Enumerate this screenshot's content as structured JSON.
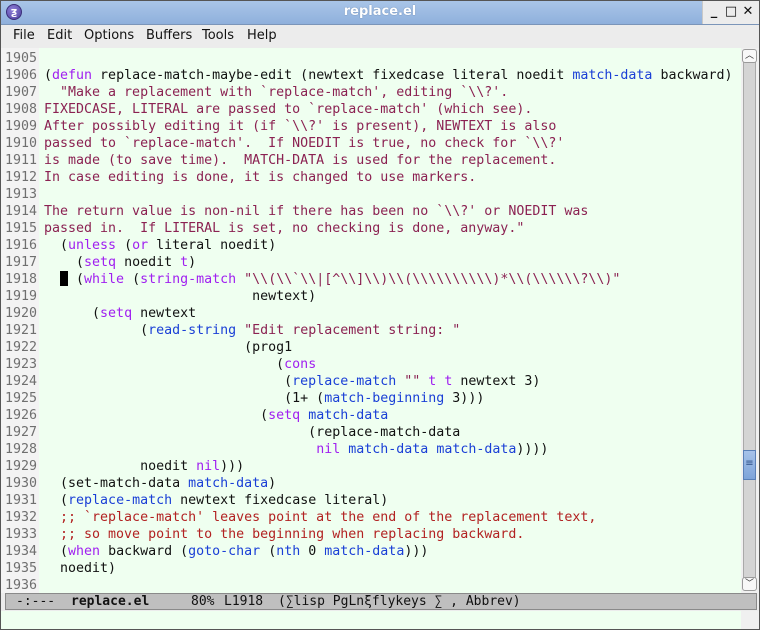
{
  "window": {
    "title": "replace.el",
    "app_icon": "emacs-icon",
    "controls": {
      "minimize": "_",
      "maximize": "□",
      "close": "✕"
    }
  },
  "menubar": {
    "items": [
      "File",
      "Edit",
      "Options",
      "Buffers",
      "Tools",
      "Help"
    ]
  },
  "editor": {
    "cursor_line": 1918,
    "lines": [
      {
        "n": "1905"
      },
      {
        "n": "1906"
      },
      {
        "n": "1907"
      },
      {
        "n": "1908"
      },
      {
        "n": "1909"
      },
      {
        "n": "1910"
      },
      {
        "n": "1911"
      },
      {
        "n": "1912"
      },
      {
        "n": "1913"
      },
      {
        "n": "1914"
      },
      {
        "n": "1915"
      },
      {
        "n": "1916"
      },
      {
        "n": "1917"
      },
      {
        "n": "1918"
      },
      {
        "n": "1919"
      },
      {
        "n": "1920"
      },
      {
        "n": "1921"
      },
      {
        "n": "1922"
      },
      {
        "n": "1923"
      },
      {
        "n": "1924"
      },
      {
        "n": "1925"
      },
      {
        "n": "1926"
      },
      {
        "n": "1927"
      },
      {
        "n": "1928"
      },
      {
        "n": "1929"
      },
      {
        "n": "1930"
      },
      {
        "n": "1931"
      },
      {
        "n": "1932"
      },
      {
        "n": "1933"
      },
      {
        "n": "1934"
      },
      {
        "n": "1935"
      },
      {
        "n": "1936"
      }
    ],
    "code": {
      "l1906": [
        "(",
        "defun",
        " replace-match-maybe-edit (newtext fixedcase literal noedit ",
        "match-data",
        " backward)"
      ],
      "l1907": "  \"Make a replacement with `replace-match', editing `\\\\?'.",
      "l1908": "FIXEDCASE, LITERAL are passed to `replace-match' (which see).",
      "l1909": "After possibly editing it (if `\\\\?' is present), NEWTEXT is also",
      "l1910": "passed to `replace-match'.  If NOEDIT is true, no check for `\\\\?'",
      "l1911": "is made (to save time).  MATCH-DATA is used for the replacement.",
      "l1912": "In case editing is done, it is changed to use markers.",
      "l1914": "The return value is non-nil if there has been no `\\\\?' or NOEDIT was",
      "l1915": "passed in.  If LITERAL is set, no checking is done, anyway.\"",
      "l1916": [
        "  (",
        "unless",
        " (",
        "or",
        " literal noedit)"
      ],
      "l1917": [
        "    (",
        "setq",
        " noedit ",
        "t",
        ")"
      ],
      "l1918": [
        " (",
        "while",
        " (",
        "string-match",
        " ",
        "\"\\\\(\\\\`\\\\|[^\\\\]\\\\)\\\\(\\\\\\\\\\\\\\\\\\\\)*\\\\(\\\\\\\\\\\\?\\\\)\""
      ],
      "l1919": "                          newtext)",
      "l1920": [
        "      (",
        "setq",
        " newtext"
      ],
      "l1921": [
        "            (",
        "read-string",
        " ",
        "\"Edit replacement string: \""
      ],
      "l1922": "                         (prog1",
      "l1923": [
        "                             (",
        "cons"
      ],
      "l1924": [
        "                              (",
        "replace-match",
        " ",
        "\"\"",
        " ",
        "t",
        " ",
        "t",
        " newtext 3)"
      ],
      "l1925": [
        "                              (1+ (",
        "match-beginning",
        " 3)))"
      ],
      "l1926": [
        "                           (",
        "setq",
        " ",
        "match-data"
      ],
      "l1927": "                                 (replace-match-data",
      "l1928": [
        "                                  ",
        "nil",
        " ",
        "match-data",
        " ",
        "match-data",
        "))))"
      ],
      "l1929": [
        "            noedit ",
        "nil",
        ")))"
      ],
      "l1930": [
        "  (set-match-data ",
        "match-data",
        ")"
      ],
      "l1931": [
        "  (",
        "replace-match",
        " newtext fixedcase literal)"
      ],
      "l1932": "  ;; `replace-match' leaves point at the end of the replacement text,",
      "l1933": "  ;; so move point to the beginning when replacing backward.",
      "l1934": [
        "  (",
        "when",
        " backward (",
        "goto-char",
        " (",
        "nth",
        " 0 ",
        "match-data",
        ")))"
      ],
      "l1935": "  noedit)"
    }
  },
  "scrollbar": {
    "position_fraction": 0.8
  },
  "modeline": {
    "status": "-:---",
    "buffer_name": "replace.el",
    "position_percent": "80%",
    "line": "L1918",
    "modes": "(∑lisp PgLnξflykeys ∑ , Abbrev)"
  }
}
